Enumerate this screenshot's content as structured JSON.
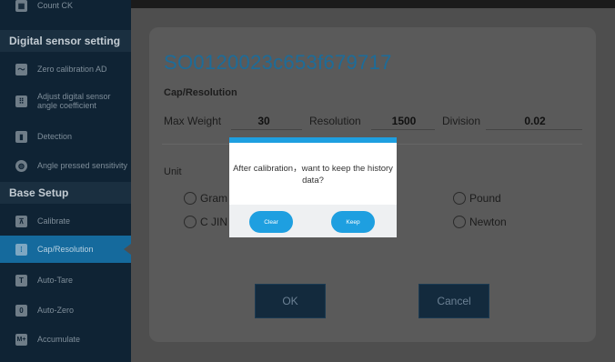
{
  "sidebar": {
    "top_item": {
      "label": "Count CK",
      "icon": "count-icon",
      "glyph": "▦"
    },
    "section_digital": "Digital sensor setting",
    "digital_items": [
      {
        "label": "Zero calibration AD",
        "icon": "zero-calibration-icon",
        "glyph": "〜"
      },
      {
        "label": "Adjust digital sensor angle coefficient",
        "icon": "angle-coefficient-icon",
        "glyph": "⠿"
      },
      {
        "label": "Detection",
        "icon": "detection-icon",
        "glyph": "▮"
      },
      {
        "label": "Angle pressed sensitivity",
        "icon": "sensitivity-icon",
        "glyph": "◍"
      }
    ],
    "section_base": "Base Setup",
    "base_items": [
      {
        "label": "Calibrate",
        "icon": "calibrate-icon",
        "glyph": "⊼"
      },
      {
        "label": "Cap/Resolution",
        "icon": "cap-resolution-icon",
        "glyph": "⁞"
      },
      {
        "label": "Auto-Tare",
        "icon": "auto-tare-icon",
        "glyph": "T"
      },
      {
        "label": "Auto-Zero",
        "icon": "auto-zero-icon",
        "glyph": "0"
      },
      {
        "label": "Accumulate",
        "icon": "accumulate-icon",
        "glyph": "M+"
      }
    ]
  },
  "main": {
    "serial": "SO0120023c653f679717",
    "cap_title": "Cap/Resolution",
    "max_weight_label": "Max Weight",
    "max_weight_value": "30",
    "resolution_label": "Resolution",
    "resolution_value": "1500",
    "division_label": "Division",
    "division_value": "0.02",
    "unit_title": "Unit",
    "units": [
      "Gram",
      "C JIN",
      "Pound",
      "Newton"
    ],
    "ok_label": "OK",
    "cancel_label": "Cancel"
  },
  "dialog": {
    "message": "After calibration，want to keep the history data?",
    "clear_label": "Clear",
    "keep_label": "Keep"
  },
  "colors": {
    "accent": "#1e9fe0",
    "sidebar_bg": "#0f2334",
    "sidebar_active": "#156a9d",
    "serial_text": "#1d6c99"
  }
}
